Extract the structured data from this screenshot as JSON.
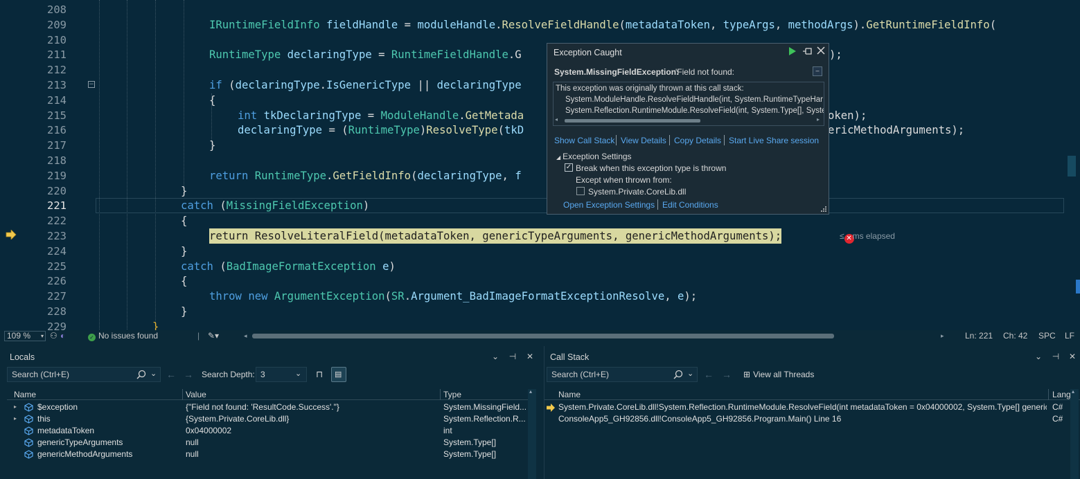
{
  "editor": {
    "lines": [
      {
        "num": "208",
        "tokens": []
      },
      {
        "num": "209",
        "tokens": [
          [
            "ty",
            "IRuntimeFieldInfo"
          ],
          [
            "pn",
            " "
          ],
          [
            "id",
            "fieldHandle"
          ],
          [
            "pn",
            " = "
          ],
          [
            "id",
            "moduleHandle"
          ],
          [
            "pn",
            "."
          ],
          [
            "fn",
            "ResolveFieldHandle"
          ],
          [
            "pn",
            "("
          ],
          [
            "id",
            "metadataToken"
          ],
          [
            "pn",
            ", "
          ],
          [
            "id",
            "typeArgs"
          ],
          [
            "pn",
            ", "
          ],
          [
            "id",
            "methodArgs"
          ],
          [
            "pn",
            ")."
          ],
          [
            "fn",
            "GetRuntimeFieldInfo"
          ],
          [
            "pn",
            "("
          ]
        ]
      },
      {
        "num": "210",
        "tokens": []
      },
      {
        "num": "211",
        "tokens": [
          [
            "ty",
            "RuntimeType"
          ],
          [
            "pn",
            " "
          ],
          [
            "id",
            "declaringType"
          ],
          [
            "pn",
            " = "
          ],
          [
            "ty",
            "RuntimeFieldHandle"
          ],
          [
            "pn",
            ".G"
          ]
        ]
      },
      {
        "num": "212",
        "tokens": []
      },
      {
        "num": "213",
        "tokens": [
          [
            "kw",
            "if"
          ],
          [
            "pn",
            " ("
          ],
          [
            "id",
            "declaringType"
          ],
          [
            "pn",
            "."
          ],
          [
            "id",
            "IsGenericType"
          ],
          [
            "pn",
            " || "
          ],
          [
            "id",
            "declaringType"
          ]
        ]
      },
      {
        "num": "214",
        "tokens": [
          [
            "pn",
            "{"
          ]
        ]
      },
      {
        "num": "215",
        "tokens": [
          [
            "kw",
            "int"
          ],
          [
            "pn",
            " "
          ],
          [
            "id",
            "tkDeclaringType"
          ],
          [
            "pn",
            " = "
          ],
          [
            "ty",
            "ModuleHandle"
          ],
          [
            "pn",
            "."
          ],
          [
            "fn",
            "GetMetada"
          ]
        ]
      },
      {
        "num": "216",
        "tokens": [
          [
            "id",
            "declaringType"
          ],
          [
            "pn",
            " = ("
          ],
          [
            "ty",
            "RuntimeType"
          ],
          [
            "pn",
            ")"
          ],
          [
            "fn",
            "ResolveType"
          ],
          [
            "pn",
            "("
          ],
          [
            "id",
            "tkD"
          ]
        ]
      },
      {
        "num": "217",
        "tokens": [
          [
            "pn",
            "}"
          ]
        ]
      },
      {
        "num": "218",
        "tokens": []
      },
      {
        "num": "219",
        "tokens": [
          [
            "kw",
            "return"
          ],
          [
            "pn",
            " "
          ],
          [
            "ty",
            "RuntimeType"
          ],
          [
            "pn",
            "."
          ],
          [
            "fn",
            "GetFieldInfo"
          ],
          [
            "pn",
            "("
          ],
          [
            "id",
            "declaringType"
          ],
          [
            "pn",
            ", "
          ],
          [
            "id",
            "f"
          ]
        ]
      },
      {
        "num": "220",
        "tokens": [
          [
            "pn",
            "}"
          ]
        ]
      },
      {
        "num": "221",
        "tokens": [
          [
            "kw",
            "catch"
          ],
          [
            "pn",
            " ("
          ],
          [
            "ty",
            "MissingFieldException"
          ],
          [
            "pn",
            ")"
          ]
        ]
      },
      {
        "num": "222",
        "tokens": [
          [
            "pn",
            "{"
          ]
        ]
      },
      {
        "num": "223",
        "tokens": [
          [
            "pn",
            "return ResolveLiteralField(metadataToken, genericTypeArguments, genericMethodArguments);"
          ]
        ]
      },
      {
        "num": "224",
        "tokens": [
          [
            "pn",
            "}"
          ]
        ]
      },
      {
        "num": "225",
        "tokens": [
          [
            "kw",
            "catch"
          ],
          [
            "pn",
            " ("
          ],
          [
            "ty",
            "BadImageFormatException"
          ],
          [
            "pn",
            " "
          ],
          [
            "id",
            "e"
          ],
          [
            "pn",
            ")"
          ]
        ]
      },
      {
        "num": "226",
        "tokens": [
          [
            "pn",
            "{"
          ]
        ]
      },
      {
        "num": "227",
        "tokens": [
          [
            "kw",
            "throw"
          ],
          [
            "pn",
            " "
          ],
          [
            "kw",
            "new"
          ],
          [
            "pn",
            " "
          ],
          [
            "ty",
            "ArgumentException"
          ],
          [
            "pn",
            "("
          ],
          [
            "ty",
            "SR"
          ],
          [
            "pn",
            "."
          ],
          [
            "id",
            "Argument_BadImageFormatExceptionResolve"
          ],
          [
            "pn",
            ", "
          ],
          [
            "id",
            "e"
          ],
          [
            "pn",
            ");"
          ]
        ]
      },
      {
        "num": "228",
        "tokens": [
          [
            "pn",
            "}"
          ]
        ]
      },
      {
        "num": "229",
        "tokens": [
          [
            "pn",
            "}"
          ]
        ]
      }
    ],
    "tail_211": ");",
    "tail_215": "oken);",
    "tail_216": "ericMethodArguments);",
    "elapsed": "ms elapsed",
    "elapsed_prefix": "≤",
    "elapsed_icon": "✕"
  },
  "status": {
    "zoom": "109 %",
    "issues": "No issues found",
    "ln": "Ln: 221",
    "ch": "Ch: 42",
    "spc": "SPC",
    "lf": "LF"
  },
  "exception_popup": {
    "title": "Exception Caught",
    "type": "System.MissingFieldException:",
    "message": "'Field not found:",
    "stack_header": "This exception was originally thrown at this call stack:",
    "stack": [
      "System.ModuleHandle.ResolveFieldHandle(int, System.RuntimeTypeHar",
      "System.Reflection.RuntimeModule.ResolveField(int, System.Type[], Syste"
    ],
    "links": [
      "Show Call Stack",
      "View Details",
      "Copy Details",
      "Start Live Share session"
    ],
    "settings_title": "Exception Settings",
    "break_label": "Break when this exception type is thrown",
    "except_label": "Except when thrown from:",
    "corelib_label": "System.Private.CoreLib.dll",
    "bottom_links": [
      "Open Exception Settings",
      "Edit Conditions"
    ]
  },
  "locals": {
    "title": "Locals",
    "search_placeholder": "Search (Ctrl+E)",
    "search_depth_label": "Search Depth:",
    "search_depth": "3",
    "columns": [
      "Name",
      "Value",
      "Type"
    ],
    "rows": [
      {
        "name": "$exception",
        "value": "{\"Field not found: 'ResultCode.Success'.\"}",
        "type": "System.MissingField...",
        "expandable": true
      },
      {
        "name": "this",
        "value": "{System.Private.CoreLib.dll}",
        "type": "System.Reflection.R...",
        "expandable": true
      },
      {
        "name": "metadataToken",
        "value": "0x04000002",
        "type": "int",
        "expandable": false
      },
      {
        "name": "genericTypeArguments",
        "value": "null",
        "type": "System.Type[]",
        "expandable": false
      },
      {
        "name": "genericMethodArguments",
        "value": "null",
        "type": "System.Type[]",
        "expandable": false
      }
    ]
  },
  "callstack": {
    "title": "Call Stack",
    "search_placeholder": "Search (Ctrl+E)",
    "view_threads": "View all Threads",
    "columns": [
      "Name",
      "Lang"
    ],
    "rows": [
      {
        "name": "System.Private.CoreLib.dll!System.Reflection.RuntimeModule.ResolveField(int metadataToken = 0x04000002, System.Type[] genericT...",
        "lang": "C#"
      },
      {
        "name": "ConsoleApp5_GH92856.dll!ConsoleApp5_GH92856.Program.Main() Line 16",
        "lang": "C#"
      }
    ]
  },
  "colors": {
    "background": "#08283a",
    "accent": "#5aa9f0",
    "keyword": "#4f9fe0",
    "type": "#4ec9b0",
    "method": "#dcdcaa",
    "identifier": "#9cdcfe",
    "exec_highlight": "#d8d8a0",
    "arrow": "#f2c94c"
  }
}
